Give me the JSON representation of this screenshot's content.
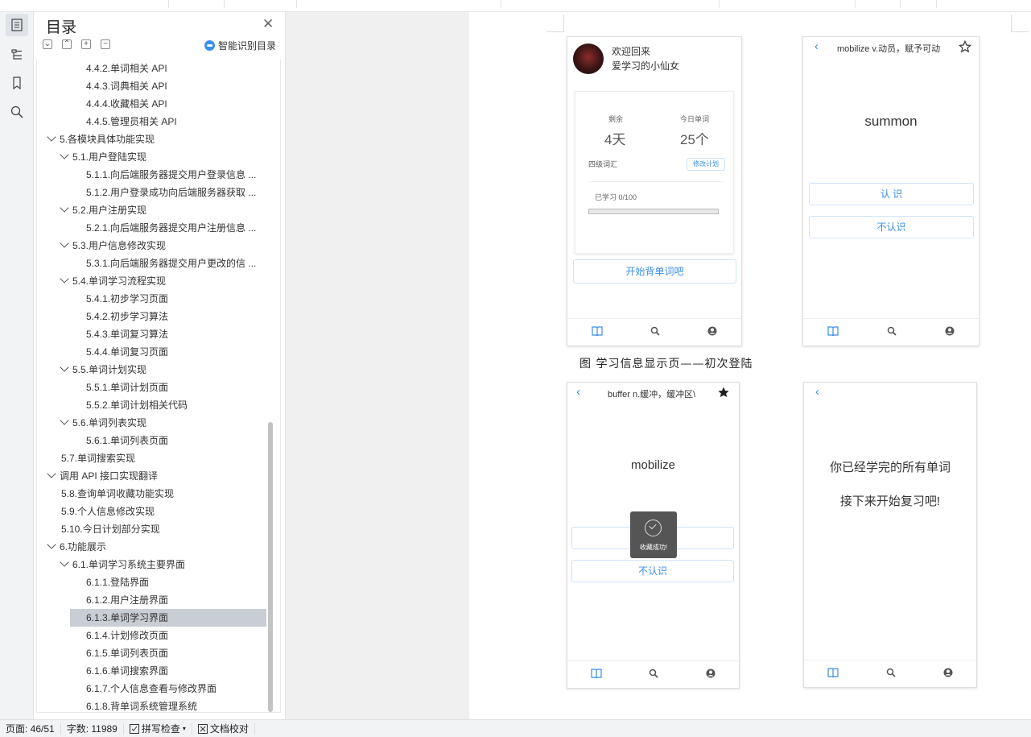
{
  "toc": {
    "title": "目录",
    "smart_label": "智能识别目录",
    "items": [
      {
        "label": "4.4.2.单词相关 API",
        "level": 3
      },
      {
        "label": "4.4.3.词典相关 API",
        "level": 3
      },
      {
        "label": "4.4.4.收藏相关 API",
        "level": 3
      },
      {
        "label": "4.4.5.管理员相关 API",
        "level": 3
      },
      {
        "label": "5.各模块具体功能实现",
        "level": 1,
        "expanded": true
      },
      {
        "label": "5.1.用户登陆实现",
        "level": 2,
        "expanded": true
      },
      {
        "label": "5.1.1.向后端服务器提交用户登录信息 ...",
        "level": 3
      },
      {
        "label": "5.1.2.用户登录成功向后端服务器获取 ...",
        "level": 3
      },
      {
        "label": "5.2.用户注册实现",
        "level": 2,
        "expanded": true
      },
      {
        "label": "5.2.1.向后端服务器提交用户注册信息 ...",
        "level": 3
      },
      {
        "label": "5.3.用户信息修改实现",
        "level": 2,
        "expanded": true
      },
      {
        "label": "5.3.1.向后端服务器提交用户更改的信 ...",
        "level": 3
      },
      {
        "label": "5.4.单词学习流程实现",
        "level": 2,
        "expanded": true
      },
      {
        "label": "5.4.1.初步学习页面",
        "level": 3
      },
      {
        "label": "5.4.2.初步学习算法",
        "level": 3
      },
      {
        "label": "5.4.3.单词复习算法",
        "level": 3
      },
      {
        "label": "5.4.4.单词复习页面",
        "level": 3
      },
      {
        "label": "5.5.单词计划实现",
        "level": 2,
        "expanded": true
      },
      {
        "label": "5.5.1.单词计划页面",
        "level": 3
      },
      {
        "label": "5.5.2.单词计划相关代码",
        "level": 3
      },
      {
        "label": "5.6.单词列表实现",
        "level": 2,
        "expanded": true
      },
      {
        "label": "5.6.1.单词列表页面",
        "level": 3
      },
      {
        "label": "5.7.单词搜索实现",
        "level": 2
      },
      {
        "label": "调用 API 接口实现翻译",
        "level": 1,
        "expanded": true
      },
      {
        "label": "5.8.查询单词收藏功能实现",
        "level": 2
      },
      {
        "label": "5.9.个人信息修改实现",
        "level": 2
      },
      {
        "label": "5.10.今日计划部分实现",
        "level": 2
      },
      {
        "label": "6.功能展示",
        "level": 1,
        "expanded": true
      },
      {
        "label": "6.1.单词学习系统主要界面",
        "level": 2,
        "expanded": true
      },
      {
        "label": "6.1.1.登陆界面",
        "level": 3
      },
      {
        "label": "6.1.2.用户注册界面",
        "level": 3
      },
      {
        "label": "6.1.3.单词学习界面",
        "level": 3,
        "selected": true
      },
      {
        "label": "6.1.4.计划修改页面",
        "level": 3
      },
      {
        "label": "6.1.5.单词列表页面",
        "level": 3
      },
      {
        "label": "6.1.6.单词搜索界面",
        "level": 3
      },
      {
        "label": "6.1.7.个人信息查看与修改界面",
        "level": 3
      },
      {
        "label": "6.1.8.背单词系统管理系统",
        "level": 3
      }
    ]
  },
  "phone1": {
    "welcome": "欢迎回来",
    "username": "爱学习的小仙女",
    "remain_label": "剩余",
    "remain_value": "4天",
    "today_label": "今日单词",
    "today_value": "25个",
    "book": "四级词汇",
    "modify_btn": "修改计划",
    "progress_text": "已学习 0/100",
    "progress": 0,
    "start_btn": "开始背单词吧"
  },
  "phone2": {
    "header": "mobilize v.动员，赋予可动",
    "word": "summon",
    "know_btn": "认 识",
    "unknown_btn": "不认识"
  },
  "caption": "图 学习信息显示页——初次登陆",
  "phone3": {
    "header": "buffer n.缓冲，缓冲区\\",
    "word": "mobilize",
    "toast": "收藏成功!",
    "unknown_btn": "不认识"
  },
  "phone4": {
    "line1": "你已经学完的所有单词",
    "line2": "接下来开始复习吧!"
  },
  "status": {
    "page": "页面: 46/51",
    "words": "字数: 11989",
    "spell": "拼写检查",
    "proof": "文档校对"
  },
  "colors": {
    "accent": "#3a8ee6",
    "selected_row": "#c9ced4"
  }
}
